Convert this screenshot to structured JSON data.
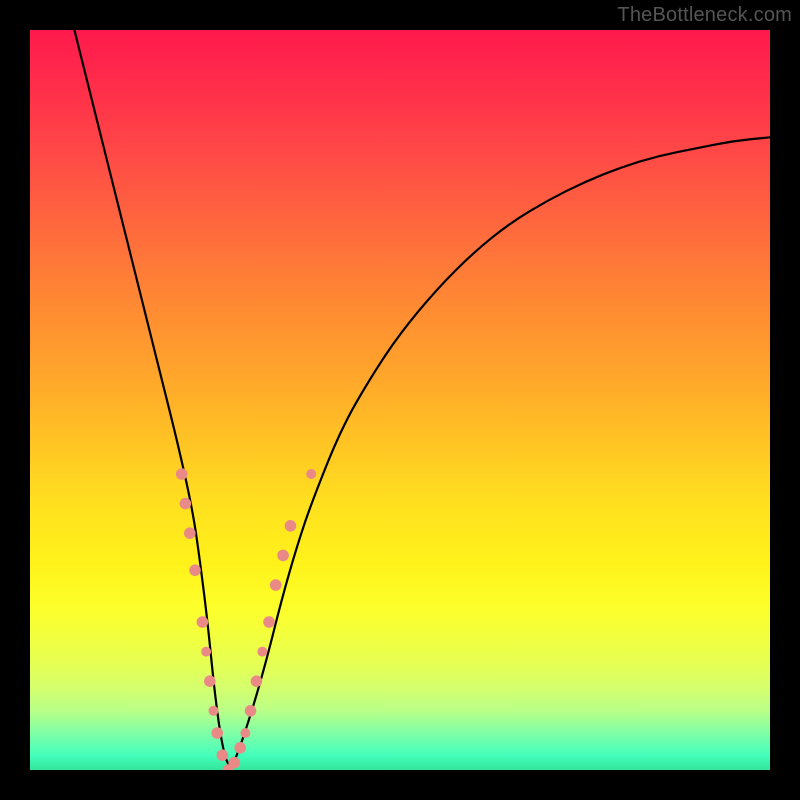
{
  "watermark": "TheBottleneck.com",
  "chart_data": {
    "type": "line",
    "title": "",
    "xlabel": "",
    "ylabel": "",
    "xlim": [
      0,
      100
    ],
    "ylim": [
      0,
      100
    ],
    "grid": false,
    "legend": false,
    "series": [
      {
        "name": "bottleneck-curve",
        "color": "#000000",
        "x": [
          6,
          8,
          10,
          12,
          14,
          16,
          18,
          20,
          22,
          23,
          24,
          25,
          26,
          27,
          28,
          30,
          32,
          34,
          36,
          38,
          42,
          46,
          50,
          55,
          60,
          65,
          70,
          75,
          80,
          85,
          90,
          95,
          100
        ],
        "values": [
          100,
          92,
          84,
          76,
          68,
          60,
          52,
          44,
          35,
          28,
          20,
          10,
          3,
          0,
          2,
          8,
          15,
          23,
          30,
          36,
          46,
          53,
          59,
          65,
          70,
          74,
          77,
          79.5,
          81.5,
          83,
          84,
          85,
          85.5
        ]
      }
    ],
    "markers": [
      {
        "x": 20.5,
        "y": 40,
        "r": 5.8
      },
      {
        "x": 21.0,
        "y": 36,
        "r": 5.8
      },
      {
        "x": 21.6,
        "y": 32,
        "r": 5.8
      },
      {
        "x": 22.3,
        "y": 27,
        "r": 5.8
      },
      {
        "x": 23.3,
        "y": 20,
        "r": 5.8
      },
      {
        "x": 23.8,
        "y": 16,
        "r": 5.0
      },
      {
        "x": 24.3,
        "y": 12,
        "r": 5.8
      },
      {
        "x": 24.8,
        "y": 8,
        "r": 5.0
      },
      {
        "x": 25.3,
        "y": 5,
        "r": 5.8
      },
      {
        "x": 26.0,
        "y": 2,
        "r": 5.8
      },
      {
        "x": 26.8,
        "y": 0,
        "r": 5.8
      },
      {
        "x": 27.6,
        "y": 1,
        "r": 5.8
      },
      {
        "x": 28.4,
        "y": 3,
        "r": 5.8
      },
      {
        "x": 29.1,
        "y": 5,
        "r": 5.0
      },
      {
        "x": 29.8,
        "y": 8,
        "r": 5.8
      },
      {
        "x": 30.6,
        "y": 12,
        "r": 5.8
      },
      {
        "x": 31.4,
        "y": 16,
        "r": 5.0
      },
      {
        "x": 32.3,
        "y": 20,
        "r": 5.8
      },
      {
        "x": 33.2,
        "y": 25,
        "r": 5.8
      },
      {
        "x": 34.2,
        "y": 29,
        "r": 5.8
      },
      {
        "x": 35.2,
        "y": 33,
        "r": 5.8
      },
      {
        "x": 38.0,
        "y": 40,
        "r": 5.0
      }
    ],
    "marker_color": "#e98a87",
    "background_gradient": {
      "top": "#ff1a4d",
      "mid": "#ffe01f",
      "bottom": "#33e59b"
    }
  }
}
